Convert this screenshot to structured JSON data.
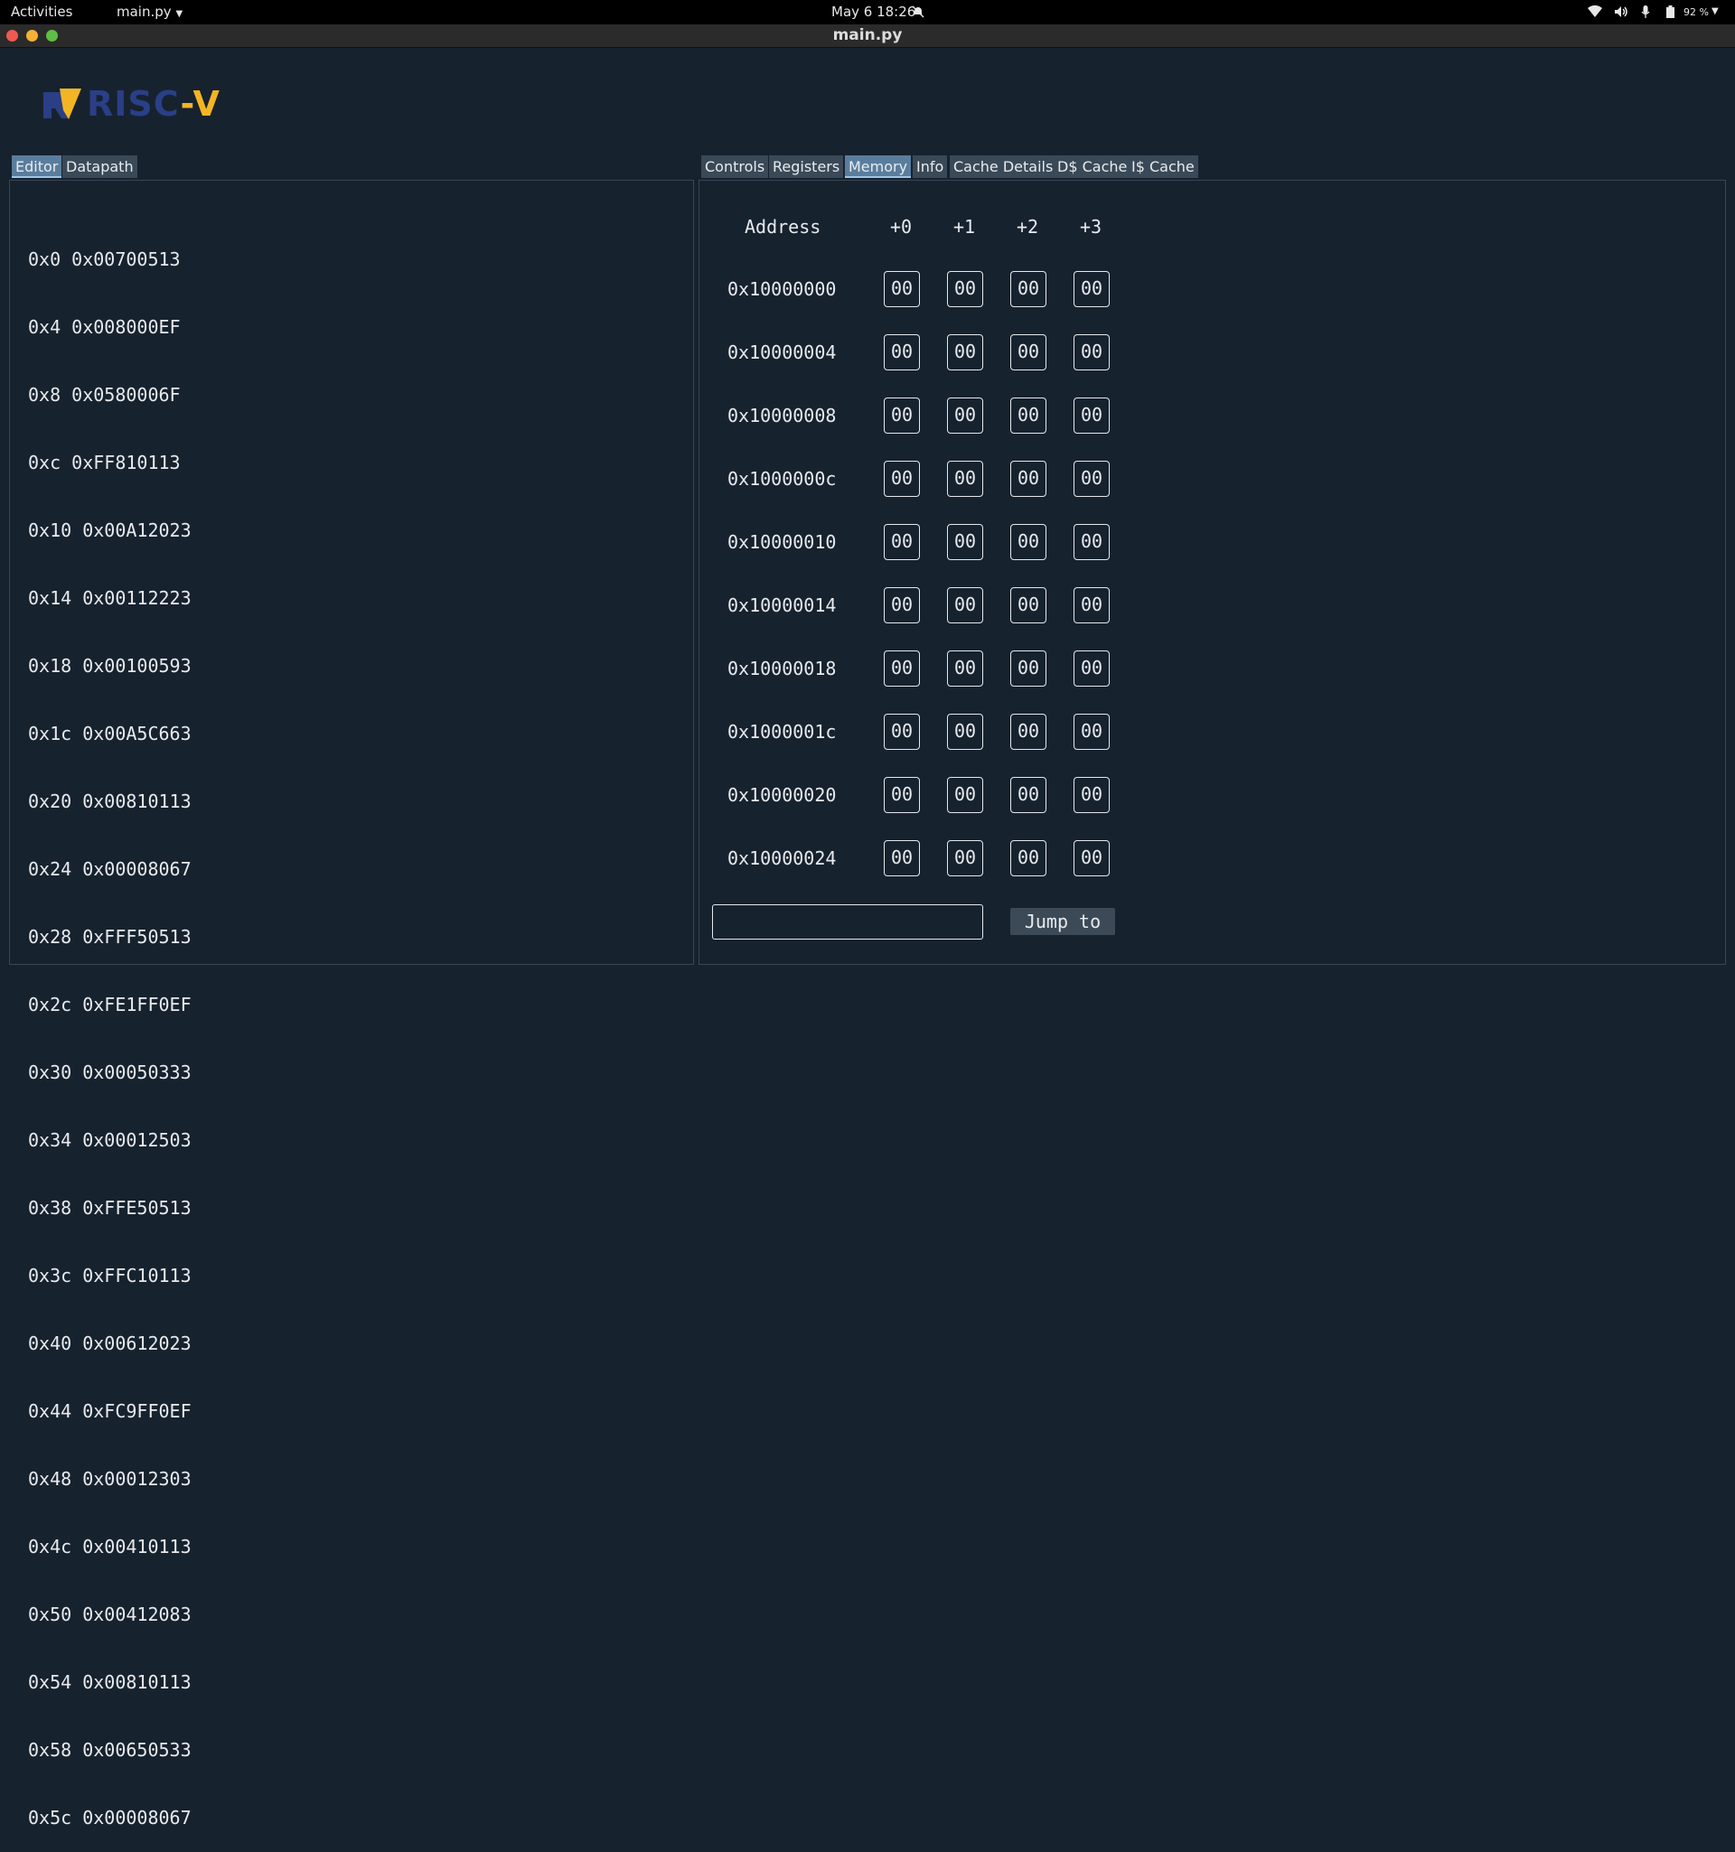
{
  "topbar": {
    "activities": "Activities",
    "app_menu": "main.py",
    "clock": "May 6  18:26",
    "battery": "92 %"
  },
  "window": {
    "title": "main.py"
  },
  "logo": {
    "text": "RISC-V"
  },
  "left_tabs": [
    "Editor",
    "Datapath"
  ],
  "right_tabs": [
    "Controls",
    "Registers",
    "Memory",
    "Info",
    "Cache Details",
    "D$ Cache",
    "I$ Cache"
  ],
  "active_left_tab": "Editor",
  "active_right_tab": "Memory",
  "editor": {
    "lines": [
      "0x0 0x00700513",
      "0x4 0x008000EF",
      "0x8 0x0580006F",
      "0xc 0xFF810113",
      "0x10 0x00A12023",
      "0x14 0x00112223",
      "0x18 0x00100593",
      "0x1c 0x00A5C663",
      "0x20 0x00810113",
      "0x24 0x00008067",
      "0x28 0xFFF50513",
      "0x2c 0xFE1FF0EF",
      "0x30 0x00050333",
      "0x34 0x00012503",
      "0x38 0xFFE50513",
      "0x3c 0xFFC10113",
      "0x40 0x00612023",
      "0x44 0xFC9FF0EF",
      "0x48 0x00012303",
      "0x4c 0x00410113",
      "0x50 0x00412083",
      "0x54 0x00810113",
      "0x58 0x00650533",
      "0x5c 0x00008067"
    ]
  },
  "memory": {
    "headers": [
      "Address",
      "+0",
      "+1",
      "+2",
      "+3"
    ],
    "rows": [
      {
        "addr": "0x10000000",
        "bytes": [
          "00",
          "00",
          "00",
          "00"
        ]
      },
      {
        "addr": "0x10000004",
        "bytes": [
          "00",
          "00",
          "00",
          "00"
        ]
      },
      {
        "addr": "0x10000008",
        "bytes": [
          "00",
          "00",
          "00",
          "00"
        ]
      },
      {
        "addr": "0x1000000c",
        "bytes": [
          "00",
          "00",
          "00",
          "00"
        ]
      },
      {
        "addr": "0x10000010",
        "bytes": [
          "00",
          "00",
          "00",
          "00"
        ]
      },
      {
        "addr": "0x10000014",
        "bytes": [
          "00",
          "00",
          "00",
          "00"
        ]
      },
      {
        "addr": "0x10000018",
        "bytes": [
          "00",
          "00",
          "00",
          "00"
        ]
      },
      {
        "addr": "0x1000001c",
        "bytes": [
          "00",
          "00",
          "00",
          "00"
        ]
      },
      {
        "addr": "0x10000020",
        "bytes": [
          "00",
          "00",
          "00",
          "00"
        ]
      },
      {
        "addr": "0x10000024",
        "bytes": [
          "00",
          "00",
          "00",
          "00"
        ]
      }
    ],
    "jump_value": "",
    "jump_label": "Jump to"
  },
  "colors": {
    "background": "#17222f",
    "tab": "#3a4957",
    "tab_active": "#5a7d9e",
    "logo_blue": "#2a3f86",
    "logo_gold": "#f4b524"
  }
}
